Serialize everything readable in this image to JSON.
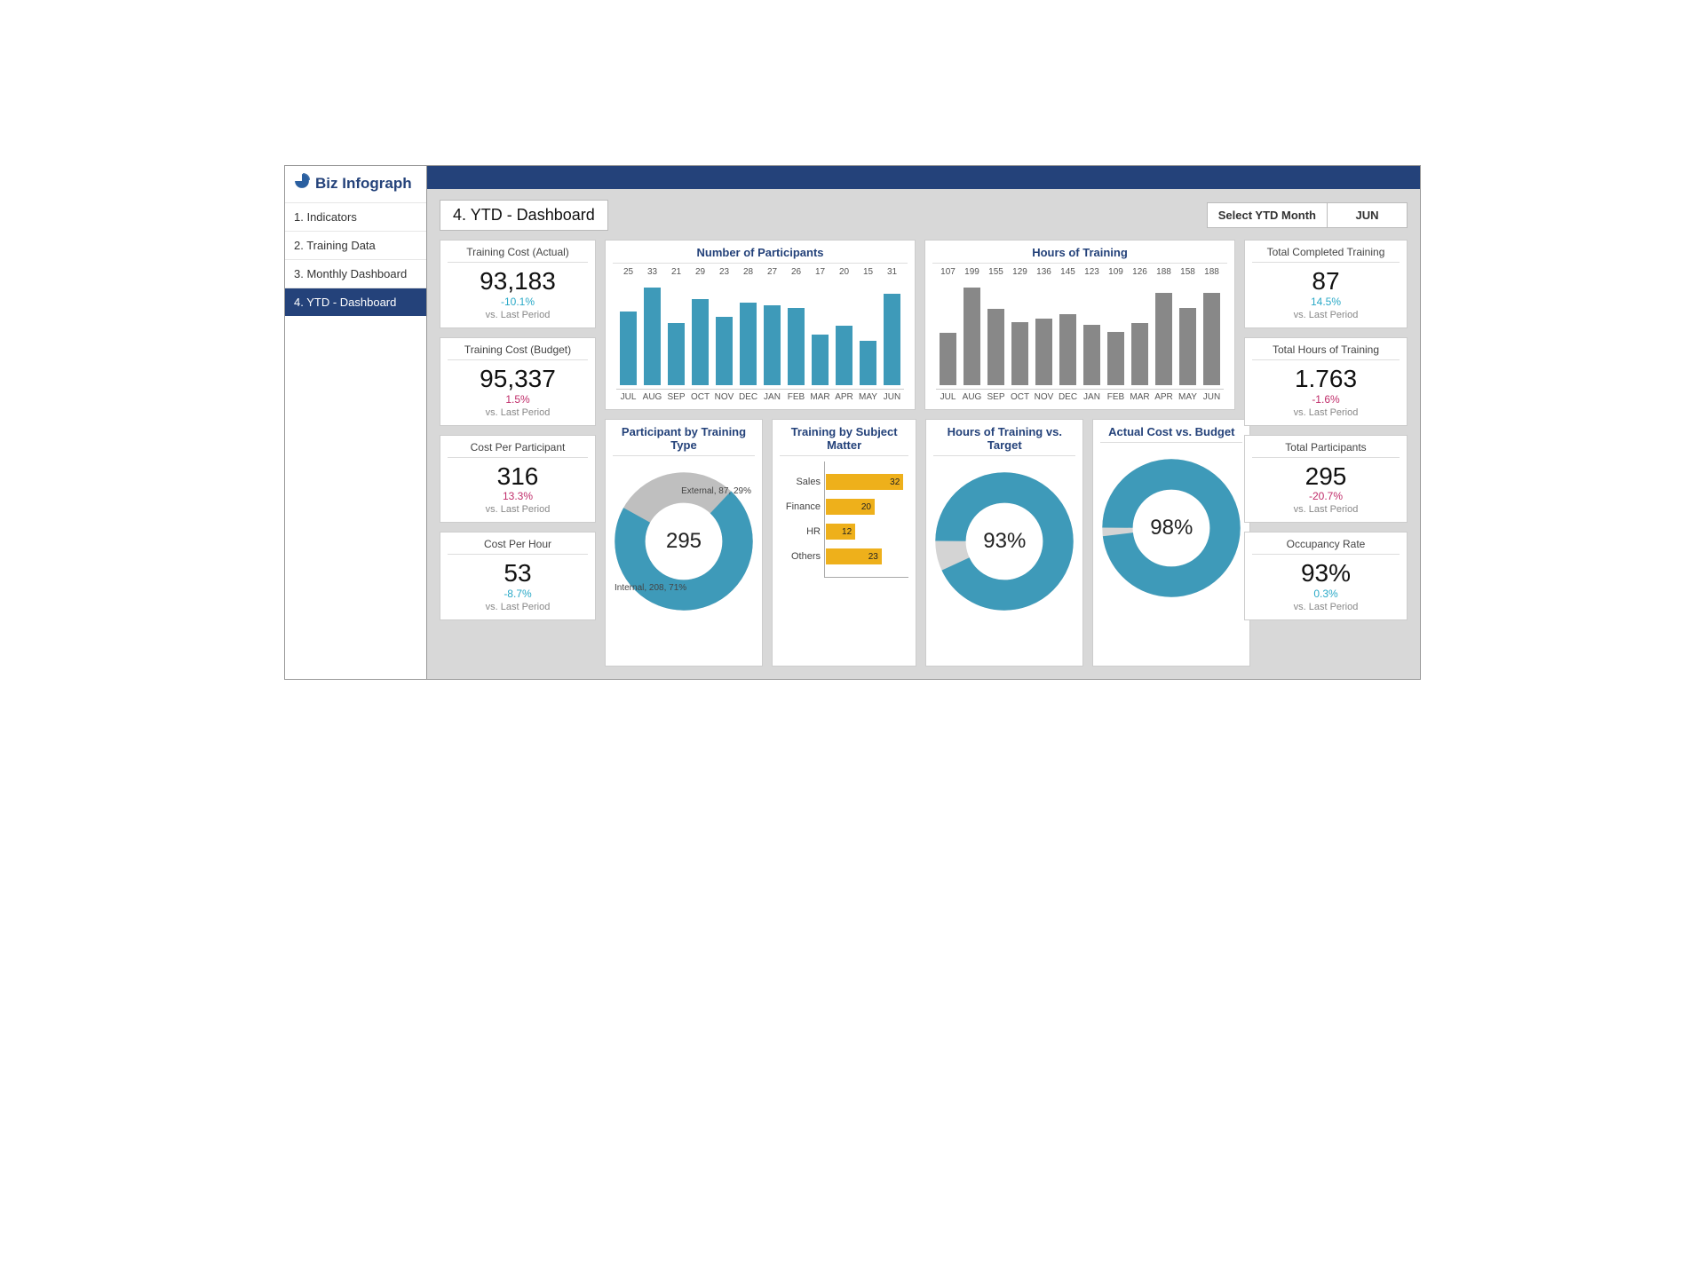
{
  "brand": "Biz Infograph",
  "nav": [
    {
      "label": "1. Indicators"
    },
    {
      "label": "2. Training Data"
    },
    {
      "label": "3. Monthly Dashboard"
    },
    {
      "label": "4. YTD - Dashboard",
      "active": true
    }
  ],
  "page_title": "4. YTD - Dashboard",
  "ytd_select": {
    "label": "Select YTD Month",
    "value": "JUN"
  },
  "kpis_left": [
    {
      "title": "Training Cost (Actual)",
      "value": "93,183",
      "delta": "-10.1%",
      "delta_sign": "pos",
      "note": "vs. Last Period"
    },
    {
      "title": "Training Cost (Budget)",
      "value": "95,337",
      "delta": "1.5%",
      "delta_sign": "neg",
      "note": "vs. Last Period"
    },
    {
      "title": "Cost Per Participant",
      "value": "316",
      "delta": "13.3%",
      "delta_sign": "neg",
      "note": "vs. Last Period"
    },
    {
      "title": "Cost Per Hour",
      "value": "53",
      "delta": "-8.7%",
      "delta_sign": "pos",
      "note": "vs. Last Period"
    }
  ],
  "kpis_right": [
    {
      "title": "Total Completed Training",
      "value": "87",
      "delta": "14.5%",
      "delta_sign": "pos",
      "note": "vs. Last Period"
    },
    {
      "title": "Total Hours of Training",
      "value": "1.763",
      "delta": "-1.6%",
      "delta_sign": "neg",
      "note": "vs. Last Period"
    },
    {
      "title": "Total Participants",
      "value": "295",
      "delta": "-20.7%",
      "delta_sign": "neg",
      "note": "vs. Last Period"
    },
    {
      "title": "Occupancy Rate",
      "value": "93%",
      "delta": "0.3%",
      "delta_sign": "pos",
      "note": "vs. Last Period"
    }
  ],
  "chart_titles": {
    "participants": "Number of Participants",
    "hours": "Hours of Training",
    "donut_type": "Participant by Training Type",
    "subject": "Training by Subject Matter",
    "hours_target": "Hours of Training vs. Target",
    "cost_budget": "Actual Cost vs. Budget"
  },
  "donut_type": {
    "center": "295",
    "internal_label": "Internal, 208, 71%",
    "external_label": "External, 87, 29%"
  },
  "gauge_hours": "93%",
  "gauge_cost": "98%",
  "chart_data": [
    {
      "type": "bar",
      "title": "Number of Participants",
      "categories": [
        "JUL",
        "AUG",
        "SEP",
        "OCT",
        "NOV",
        "DEC",
        "JAN",
        "FEB",
        "MAR",
        "APR",
        "MAY",
        "JUN"
      ],
      "values": [
        25,
        33,
        21,
        29,
        23,
        28,
        27,
        26,
        17,
        20,
        15,
        31
      ],
      "color": "#3e9ab9"
    },
    {
      "type": "bar",
      "title": "Hours of Training",
      "categories": [
        "JUL",
        "AUG",
        "SEP",
        "OCT",
        "NOV",
        "DEC",
        "JAN",
        "FEB",
        "MAR",
        "APR",
        "MAY",
        "JUN"
      ],
      "values": [
        107,
        199,
        155,
        129,
        136,
        145,
        123,
        109,
        126,
        188,
        158,
        188
      ],
      "color": "#888888"
    },
    {
      "type": "pie",
      "title": "Participant by Training Type",
      "series": [
        {
          "name": "Internal",
          "value": 208,
          "pct": 71
        },
        {
          "name": "External",
          "value": 87,
          "pct": 29
        }
      ],
      "total": 295
    },
    {
      "type": "bar",
      "title": "Training by Subject Matter",
      "orientation": "horizontal",
      "categories": [
        "Sales",
        "Finance",
        "HR",
        "Others"
      ],
      "values": [
        32,
        20,
        12,
        23
      ],
      "color": "#eeb01b"
    },
    {
      "type": "pie",
      "title": "Hours of Training vs. Target",
      "series": [
        {
          "name": "Actual",
          "value": 93
        },
        {
          "name": "Gap",
          "value": 7
        }
      ]
    },
    {
      "type": "pie",
      "title": "Actual Cost vs. Budget",
      "series": [
        {
          "name": "Actual",
          "value": 98
        },
        {
          "name": "Gap",
          "value": 2
        }
      ]
    }
  ]
}
